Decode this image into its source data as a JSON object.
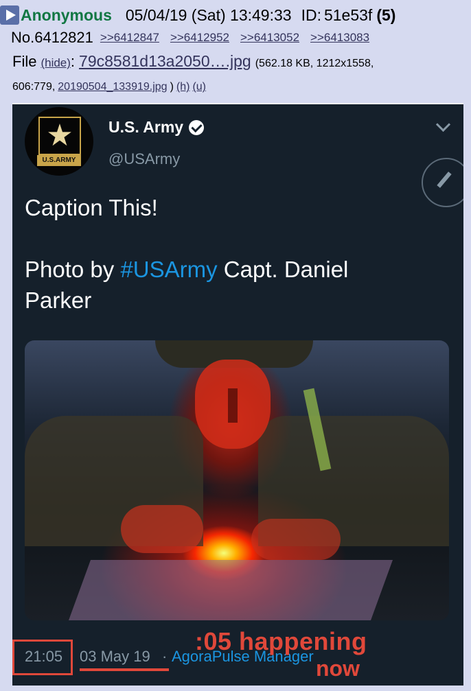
{
  "post": {
    "name": "Anonymous",
    "datetime": "05/04/19 (Sat) 13:49:33",
    "id_label": "ID:",
    "id_value": "51e53f",
    "post_count": "(5)",
    "number_label": "No.6412821",
    "replies": [
      ">>6412847",
      ">>6412952",
      ">>6413052",
      ">>6413083"
    ],
    "file_label": "File",
    "hide_label": "(hide)",
    "colon": ":",
    "filename": "79c8581d13a2050….jpg",
    "fileinfo": "(562.18 KB, 1212x1558,",
    "fileinfo2": "606:779,",
    "original_filename": "20190504_133919.jpg",
    "close_paren": ")",
    "h_link": "(h)",
    "u_link": "(u)"
  },
  "tweet": {
    "display_name": "U.S. Army",
    "handle": "@USArmy",
    "avatar_tag": "U.S.ARMY",
    "avatar_star": "★",
    "text_line1": "Caption This!",
    "text_photo_by": "Photo by ",
    "text_hashtag": "#USArmy",
    "text_rest": " Capt. Daniel Parker",
    "time": "21:05",
    "date": "03 May 19",
    "separator": "·",
    "client": "AgoraPulse Manager",
    "annotation_line1": ":05 happening",
    "annotation_line2": "now"
  },
  "icons": {
    "play": "play-icon",
    "verified": "verified-icon",
    "chevron": "chevron-down-icon",
    "compose": "compose-icon"
  },
  "colors": {
    "board_bg": "#d6daf0",
    "name_green": "#117743",
    "link": "#34345c",
    "tweet_bg": "#15202b",
    "twitter_blue": "#1b95e0",
    "annotation_red": "#e0483a"
  }
}
